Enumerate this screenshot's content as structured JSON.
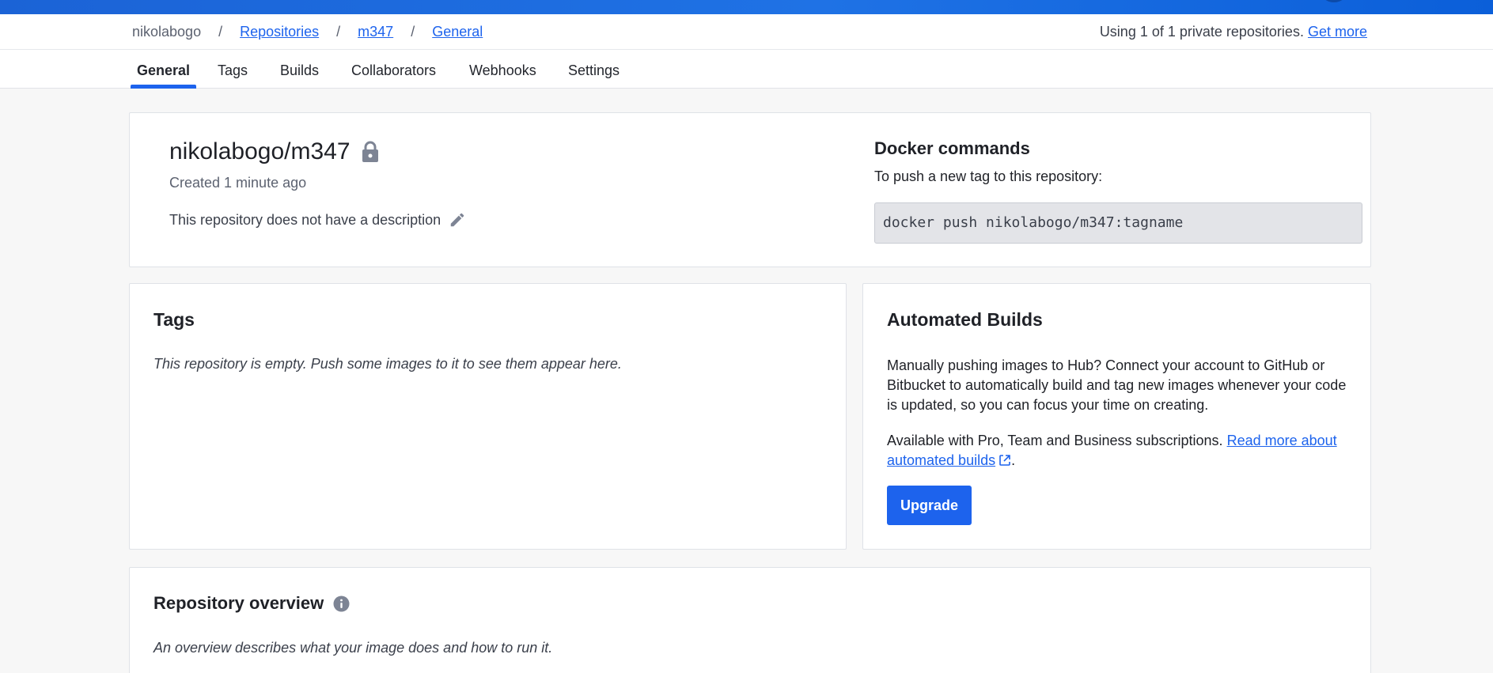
{
  "breadcrumb": {
    "user": "nikolabogo",
    "separator": "/",
    "repositories": "Repositories",
    "repo": "m347",
    "current": "General"
  },
  "usage": {
    "text": "Using 1 of 1 private repositories.",
    "link": "Get more"
  },
  "tabs": [
    {
      "label": "General",
      "active": true
    },
    {
      "label": "Tags",
      "active": false
    },
    {
      "label": "Builds",
      "active": false
    },
    {
      "label": "Collaborators",
      "active": false
    },
    {
      "label": "Webhooks",
      "active": false
    },
    {
      "label": "Settings",
      "active": false
    }
  ],
  "repo": {
    "title": "nikolabogo/m347",
    "created": "Created 1 minute ago",
    "description": "This repository does not have a description",
    "icons": [
      "lock-icon",
      "pencil-icon"
    ]
  },
  "docker": {
    "heading": "Docker commands",
    "subtitle": "To push a new tag to this repository:",
    "command": "docker push nikolabogo/m347:tagname"
  },
  "tags_card": {
    "heading": "Tags",
    "empty": "This repository is empty. Push some images to it to see them appear here."
  },
  "automated_builds": {
    "heading": "Automated Builds",
    "paragraph": "Manually pushing images to Hub? Connect your account to GitHub or Bitbucket to automatically build and tag new images whenever your code is updated, so you can focus your time on creating.",
    "availability": "Available with Pro, Team and Business subscriptions.",
    "link": "Read more about automated builds",
    "period": ".",
    "button": "Upgrade",
    "icons": [
      "external-link-icon"
    ]
  },
  "overview": {
    "heading": "Repository overview",
    "text": "An overview describes what your image does and how to run it.",
    "icons": [
      "info-icon"
    ]
  },
  "colors": {
    "accent": "#1d63ed",
    "topbar": "#1b63d6",
    "background": "#f7f7f7"
  }
}
